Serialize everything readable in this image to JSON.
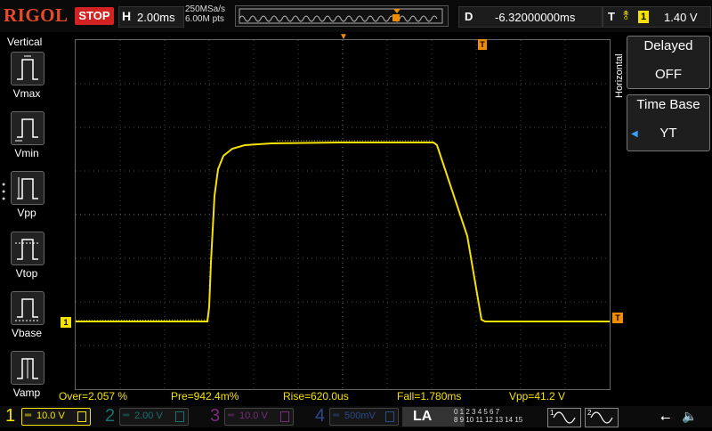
{
  "top_bar": {
    "brand": "RIGOL",
    "run_state": "STOP",
    "horizontal_label": "H",
    "timebase": "2.00ms",
    "sample_rate": "250MSa/s",
    "memory_depth": "6.00M pts",
    "delay_label": "D",
    "delay_value": "-6.32000000ms",
    "trigger_label": "T",
    "trigger_source": "1",
    "trigger_level": "1.40 V"
  },
  "left_menu": {
    "title": "Vertical",
    "items": [
      {
        "label": "Vmax",
        "icon": "vmax-icon"
      },
      {
        "label": "Vmin",
        "icon": "vmin-icon"
      },
      {
        "label": "Vpp",
        "icon": "vpp-icon"
      },
      {
        "label": "Vtop",
        "icon": "vtop-icon"
      },
      {
        "label": "Vbase",
        "icon": "vbase-icon"
      },
      {
        "label": "Vamp",
        "icon": "vamp-icon"
      }
    ]
  },
  "right_menu": {
    "title": "Horizontal",
    "delayed": {
      "label": "Delayed",
      "value": "OFF"
    },
    "time_base": {
      "label": "Time Base",
      "value": "YT"
    }
  },
  "screen": {
    "ch1_marker": "1",
    "trigger_marker": "T",
    "trace_color": "#f5e200",
    "trigger_color": "#f08c00"
  },
  "measurements": {
    "overshoot": "Over=2.057 %",
    "preshoot": "Pre=942.4m%",
    "rise": "Rise=620.0us",
    "fall": "Fall=1.780ms",
    "vpp": "Vpp=41.2 V"
  },
  "channels": [
    {
      "num": "1",
      "scale": "10.0 V",
      "color": "#f5e200",
      "active": true
    },
    {
      "num": "2",
      "scale": "2.00 V",
      "color": "#00c0c0",
      "active": false
    },
    {
      "num": "3",
      "scale": "10.0 V",
      "color": "#d03cd0",
      "active": false
    },
    {
      "num": "4",
      "scale": "500mV",
      "color": "#3a7ee8",
      "active": false
    }
  ],
  "logic_analyzer": {
    "label": "LA",
    "row1": "0 1 2 3  4 5 6 7",
    "row2": "8 9 10 11  12 13 14 15"
  },
  "generators": [
    {
      "num": "1",
      "icon": "sine-wave-icon"
    },
    {
      "num": "2",
      "icon": "sine-wave-icon"
    }
  ]
}
